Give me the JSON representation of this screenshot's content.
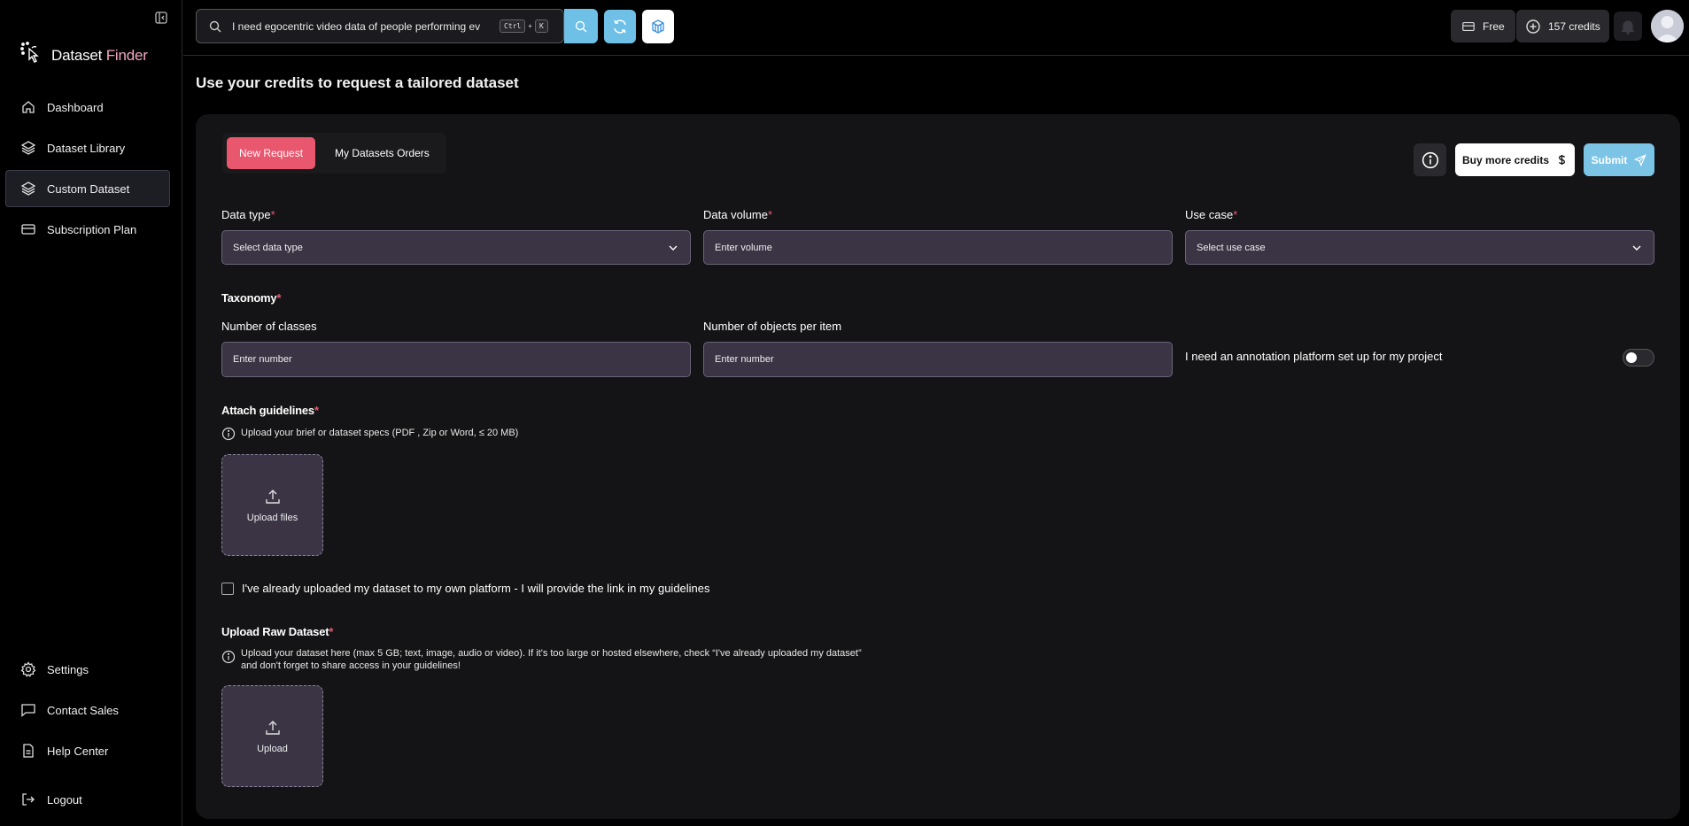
{
  "app": {
    "name_main": "Dataset",
    "name_accent": "Finder"
  },
  "sidebar": {
    "items": [
      {
        "label": "Dashboard",
        "icon": "home-icon"
      },
      {
        "label": "Dataset Library",
        "icon": "layers-icon"
      },
      {
        "label": "Custom Dataset",
        "icon": "layers-icon",
        "active": true
      },
      {
        "label": "Subscription Plan",
        "icon": "card-icon"
      }
    ],
    "bottom_items": [
      {
        "label": "Settings",
        "icon": "gear-icon"
      },
      {
        "label": "Contact Sales",
        "icon": "chat-icon"
      },
      {
        "label": "Help Center",
        "icon": "document-icon"
      }
    ],
    "logout_label": "Logout"
  },
  "topbar": {
    "search_value": "I need egocentric video data of people performing ev",
    "shortcut_ctrl": "Ctrl",
    "shortcut_plus": "+",
    "shortcut_key": "K",
    "plan_label": "Free",
    "credits_label": "157 credits"
  },
  "page": {
    "title": "Use your credits to request a tailored dataset"
  },
  "form": {
    "tabs": [
      "New Request",
      "My Datasets Orders"
    ],
    "buy_label": "Buy more credits",
    "submit_label": "Submit",
    "data_type_label": "Data type",
    "data_type_placeholder": "Select data type",
    "data_volume_label": "Data volume",
    "data_volume_placeholder": "Enter volume",
    "use_case_label": "Use case",
    "use_case_placeholder": "Select use case",
    "taxonomy_title": "Taxonomy",
    "classes_label": "Number of classes",
    "classes_placeholder": "Enter number",
    "objects_label": "Number of objects per item",
    "objects_placeholder": "Enter number",
    "annotation_toggle_label": "I need an annotation platform set up for my project",
    "annotation_toggle_on": false,
    "guidelines_title": "Attach guidelines",
    "guidelines_hint": "Upload your brief or dataset specs (PDF , Zip or Word, ≤ 20 MB)",
    "upload_files_label": "Upload files",
    "already_uploaded_label": "I've already uploaded my dataset to my own platform - I will provide the link in my guidelines",
    "raw_title": "Upload Raw Dataset",
    "raw_hint": "Upload your dataset here (max 5 GB; text, image, audio or video). If it's too large or hosted elsewhere, check “I've already uploaded my dataset” and don't forget to share access in your guidelines!",
    "upload_label": "Upload",
    "required_mark": "*"
  },
  "colors": {
    "accent_pink": "#e8576e",
    "accent_blue": "#6ec0e6",
    "field_bg": "#3a3445"
  }
}
